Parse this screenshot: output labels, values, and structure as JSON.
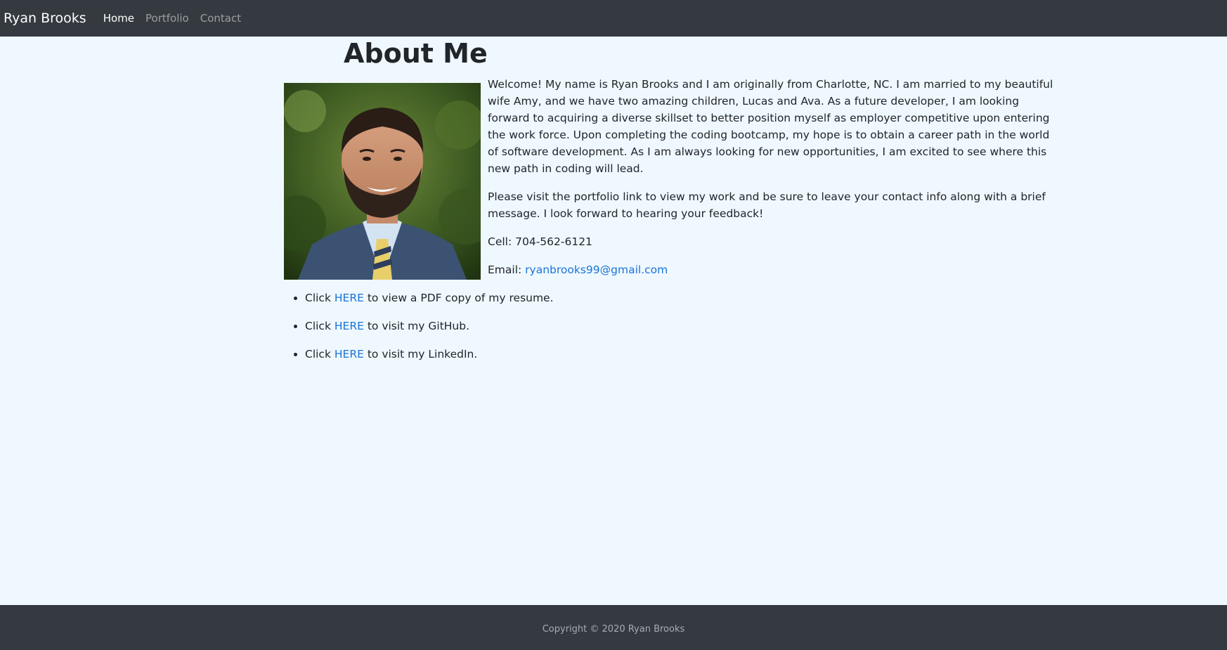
{
  "nav": {
    "brand": "Ryan Brooks",
    "items": [
      {
        "label": "Home",
        "active": true
      },
      {
        "label": "Portfolio",
        "active": false
      },
      {
        "label": "Contact",
        "active": false
      }
    ]
  },
  "main": {
    "heading": "About Me",
    "photo_alt": "portrait photo",
    "bio": {
      "p1": "Welcome! My name is Ryan Brooks and I am originally from Charlotte, NC. I am married to my beautiful wife Amy, and we have two amazing children, Lucas and Ava. As a future developer, I am looking forward to acquiring a diverse skillset to better position myself as employer competitive upon entering the work force. Upon completing the coding bootcamp, my hope is to obtain a career path in the world of software development. As I am always looking for new opportunities, I am excited to see where this new path in coding will lead.",
      "p2": "Please visit the portfolio link to view my work and be sure to leave your contact info along with a brief message. I look forward to hearing your feedback!",
      "cell": "Cell: 704-562-6121",
      "email_label": "Email:",
      "email": "ryanbrooks99@gmail.com"
    },
    "links": [
      {
        "prefix": "Click",
        "link": "HERE",
        "suffix": "to view a PDF copy of my resume."
      },
      {
        "prefix": "Click",
        "link": "HERE",
        "suffix": "to visit my GitHub."
      },
      {
        "prefix": "Click",
        "link": "HERE",
        "suffix": "to visit my LinkedIn."
      }
    ]
  },
  "footer": {
    "copyright": "Copyright © 2020 Ryan Brooks"
  },
  "colors": {
    "navbar": "#343a40",
    "page_bg": "#eff8ff",
    "link": "#1a73d6"
  }
}
